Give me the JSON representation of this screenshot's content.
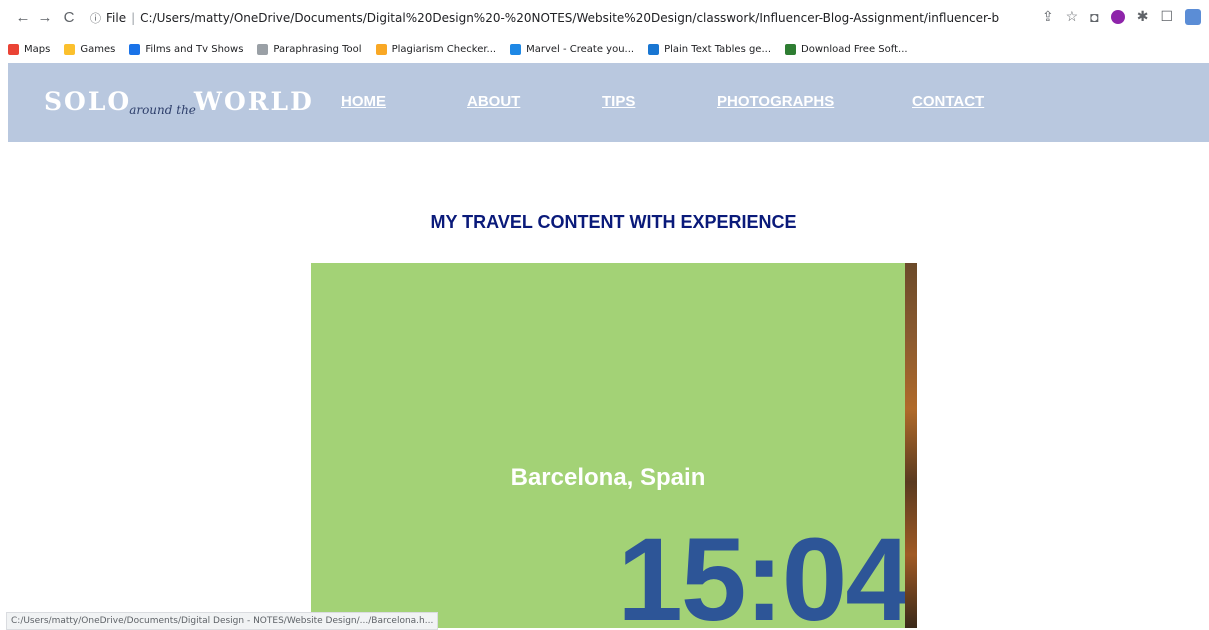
{
  "browser": {
    "back": "←",
    "forward": "→",
    "reload": "C",
    "info": "ⓘ",
    "file_label": "File",
    "url": "C:/Users/matty/OneDrive/Documents/Digital%20Design%20-%20NOTES/Website%20Design/classwork/Influencer-Blog-Assignment/influencer-blog/Destinations.html",
    "share_icon": "⇪",
    "star_icon": "☆",
    "camera_icon": "◘",
    "puzzle_icon": "✱",
    "sidebar_icon": "☐"
  },
  "bookmarks": [
    {
      "label": "Maps",
      "color": "#ea4335",
      "icon": "maps-icon"
    },
    {
      "label": "Games",
      "color": "#fbc02d",
      "icon": "folder-icon"
    },
    {
      "label": "Films and Tv Shows",
      "color": "#1a73e8",
      "icon": "film-icon"
    },
    {
      "label": "Paraphrasing Tool",
      "color": "#9aa0a6",
      "icon": "pen-icon"
    },
    {
      "label": "Plagiarism Checker...",
      "color": "#f9a825",
      "icon": "plagiarism-icon"
    },
    {
      "label": "Marvel - Create you...",
      "color": "#1e88e5",
      "icon": "marvel-icon"
    },
    {
      "label": "Plain Text Tables ge...",
      "color": "#1976d2",
      "icon": "table-icon"
    },
    {
      "label": "Download Free Soft...",
      "color": "#2e7d32",
      "icon": "download-icon"
    }
  ],
  "site": {
    "logo_left": "SOLO",
    "logo_script": "around the",
    "logo_right": "WORLD",
    "nav": [
      "HOME",
      "ABOUT",
      "TIPS",
      "PHOTOGRAPHS",
      "CONTACT"
    ]
  },
  "content": {
    "heading": "MY TRAVEL CONTENT WITH EXPERIENCE",
    "city": "Barcelona, Spain",
    "time": "15:04"
  },
  "status_bar": "C:/Users/matty/OneDrive/Documents/Digital Design - NOTES/Website Design/.../Barcelona.h..."
}
